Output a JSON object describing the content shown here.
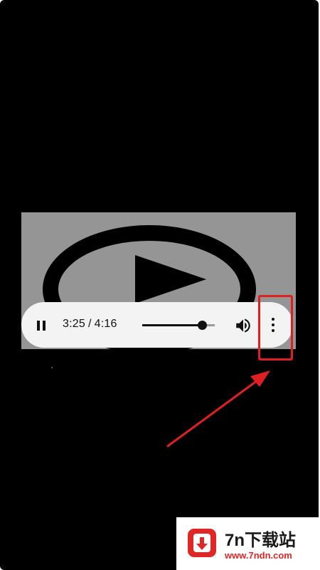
{
  "player": {
    "current_time": "3:25",
    "separator": "/",
    "duration": "4:16",
    "progress_fraction": 0.82,
    "icons": {
      "pause": "pause-icon",
      "volume": "volume-icon",
      "more": "more-vert-icon"
    }
  },
  "annotation": {
    "highlight_color": "#e02020",
    "target": "more-options-button"
  },
  "watermark": {
    "title": "7n下载站",
    "url": "www.7ndn.com",
    "brand_color": "#e12626"
  }
}
